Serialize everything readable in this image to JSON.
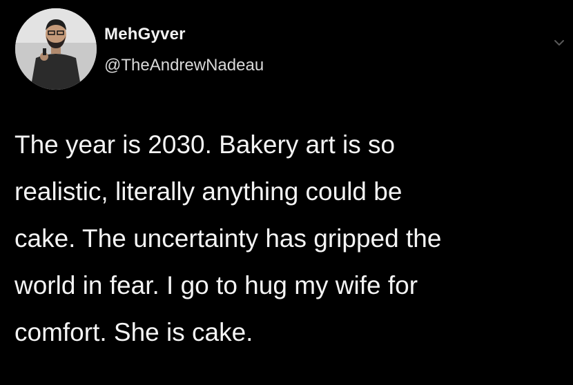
{
  "author": {
    "display_name": "MehGyver",
    "handle": "@TheAndrewNadeau",
    "avatar_icon": "avatar-photo-icon",
    "menu_icon": "chevron-down-icon"
  },
  "tweet": {
    "lines": [
      "The year is 2030. Bakery art is so",
      "realistic, literally anything could be",
      "cake. The uncertainty has gripped the",
      "world in fear. I go to hug my wife for",
      "comfort. She is cake."
    ]
  },
  "colors": {
    "background": "#000000",
    "text": "#f4f4f4",
    "handle": "#d9d9d9"
  }
}
